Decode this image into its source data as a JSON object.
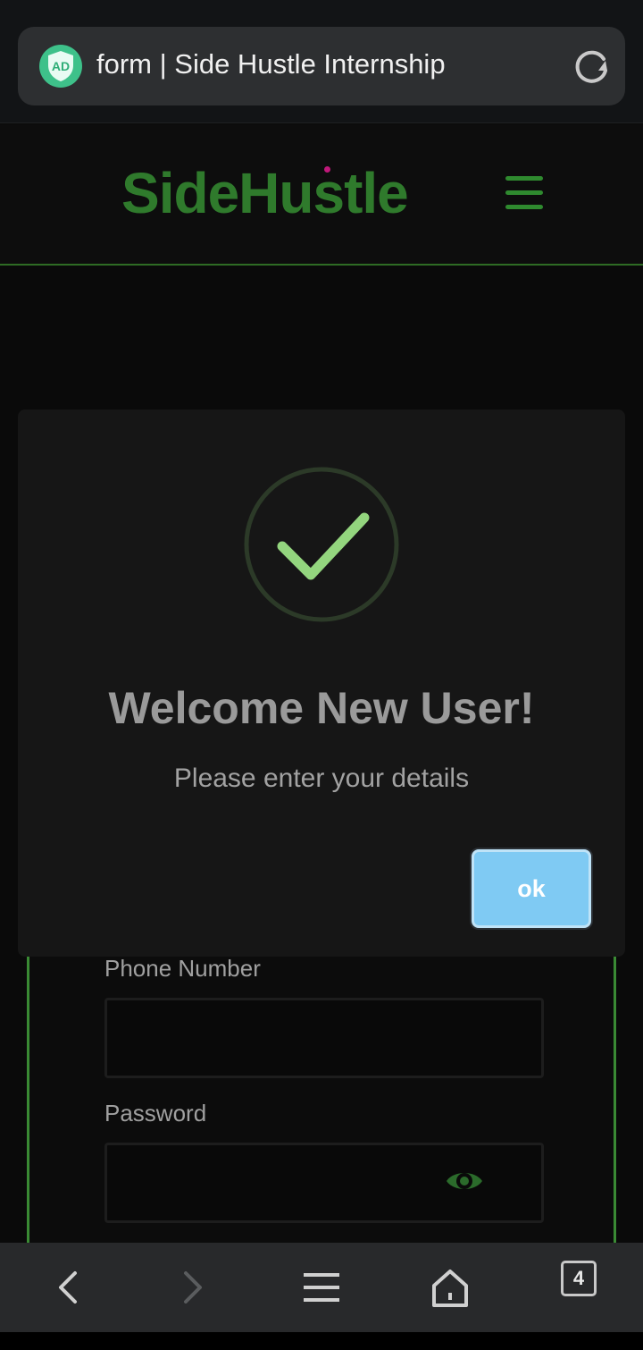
{
  "browser": {
    "ad_badge": "AD",
    "url_title": "form | Side Hustle Internship",
    "tab_count": "4"
  },
  "site": {
    "logo_text": "SideHustle",
    "brand_color": "#2f7a2c"
  },
  "modal": {
    "title": "Welcome New User!",
    "message": "Please enter your details",
    "ok_label": "ok",
    "icon": "success-check-icon",
    "accent_color": "#7fcaf3"
  },
  "form": {
    "phone_label": "Phone Number",
    "phone_value": "",
    "password_label": "Password",
    "password_value": ""
  },
  "icons": {
    "reload": "reload-icon",
    "menu": "hamburger-menu-icon",
    "eye": "eye-icon",
    "back": "back-arrow-icon",
    "forward": "forward-arrow-icon",
    "tabs_menu": "menu-lines-icon",
    "home": "home-icon"
  }
}
